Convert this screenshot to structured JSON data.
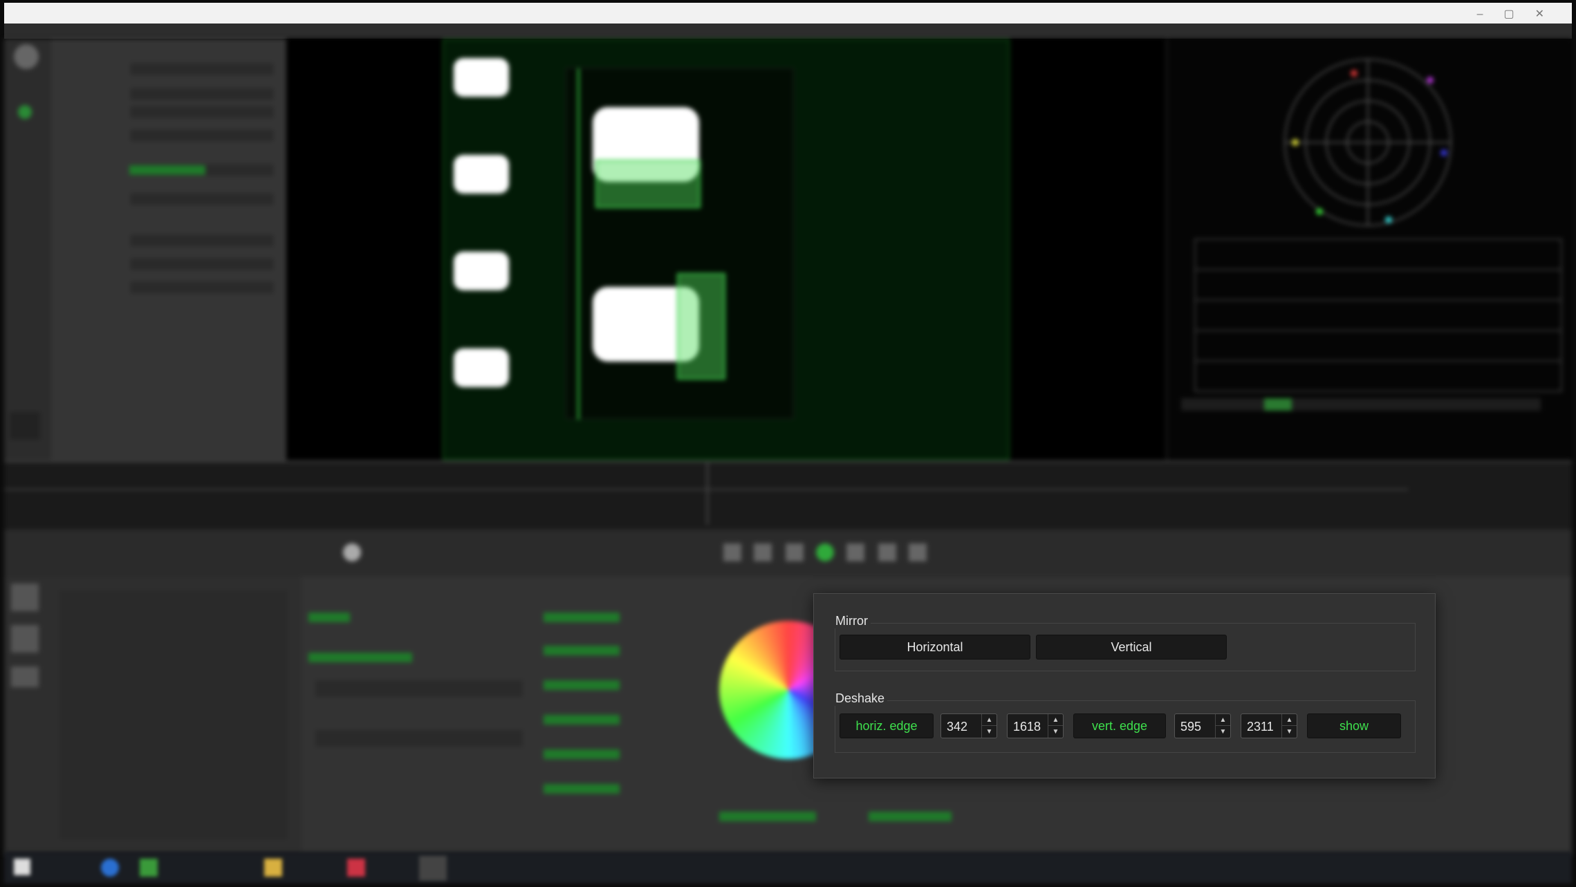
{
  "dialog": {
    "mirror": {
      "title": "Mirror",
      "horizontal_label": "Horizontal",
      "vertical_label": "Vertical"
    },
    "deshake": {
      "title": "Deshake",
      "horiz_edge_label": "horiz. edge",
      "horiz_min": "342",
      "horiz_max": "1618",
      "vert_edge_label": "vert. edge",
      "vert_min": "595",
      "vert_max": "2311",
      "show_label": "show"
    }
  },
  "icons": {
    "spin_up": "up-arrow-icon",
    "spin_down": "down-arrow-icon"
  },
  "colors": {
    "accent_green": "#3ee04d",
    "dialog_bg": "#323232",
    "button_bg": "#1a1a1a"
  }
}
